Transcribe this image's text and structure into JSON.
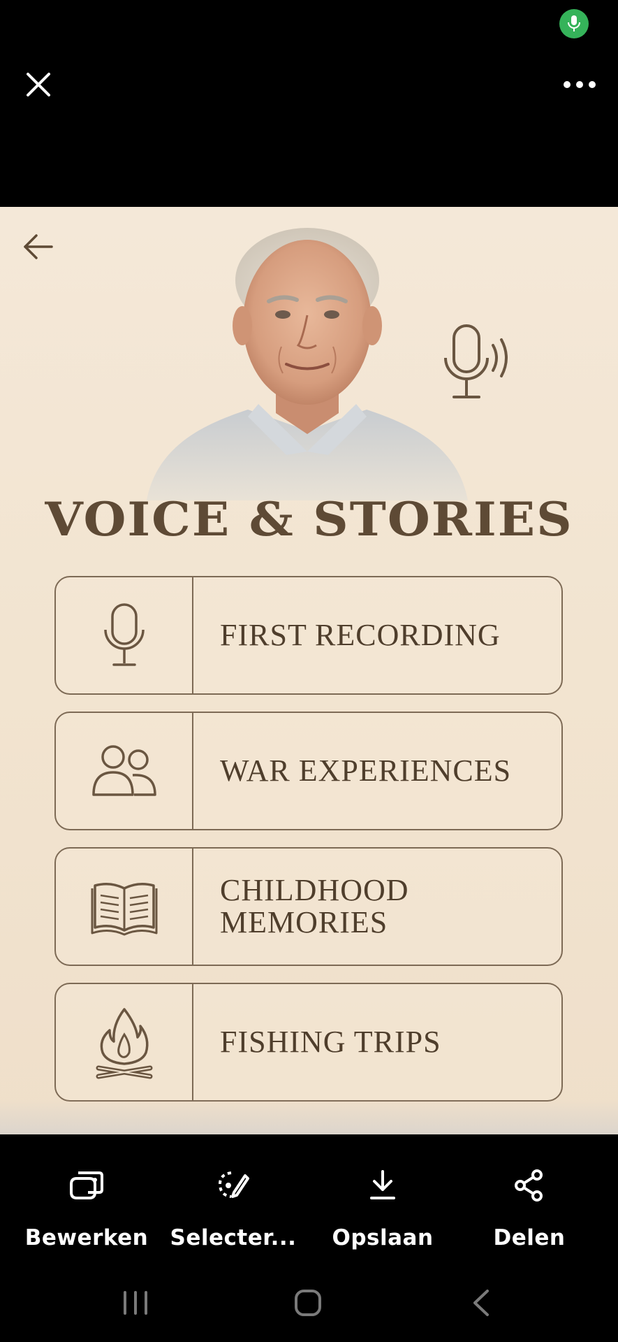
{
  "viewer": {
    "close_icon": "close-icon",
    "more_icon": "more-horizontal-icon",
    "mic_indicator_icon": "microphone-icon",
    "mic_indicator_color": "#35b35a"
  },
  "image": {
    "back_icon": "arrow-left-icon",
    "title": "VOICE & STORIES",
    "cards": [
      {
        "icon": "microphone-icon",
        "label": "FIRST RECORDING"
      },
      {
        "icon": "people-icon",
        "label": "WAR EXPERIENCES"
      },
      {
        "icon": "open-book-icon",
        "label": "CHILDHOOD\nMEMORIES"
      },
      {
        "icon": "campfire-icon",
        "label": "FISHING TRIPS"
      }
    ],
    "colors": {
      "background": "#f2e4d0",
      "ink": "#5e4a35",
      "border": "#7d6a55"
    }
  },
  "toolbar": {
    "items": [
      {
        "icon": "edit-icon",
        "label": "Bewerken"
      },
      {
        "icon": "select-icon",
        "label": "Selecter..."
      },
      {
        "icon": "download-icon",
        "label": "Opslaan"
      },
      {
        "icon": "share-icon",
        "label": "Delen"
      }
    ]
  },
  "system_nav": {
    "recents_icon": "recents-icon",
    "home_icon": "home-icon",
    "back_icon": "back-chevron-icon"
  }
}
